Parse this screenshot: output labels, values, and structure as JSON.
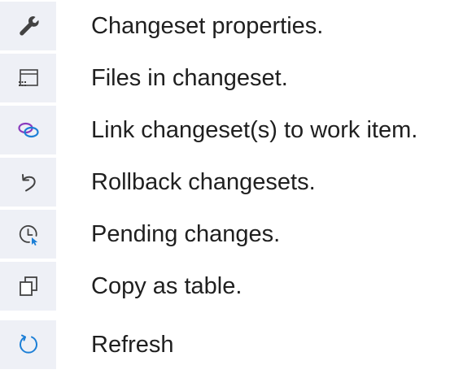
{
  "items": [
    {
      "icon": "wrench-icon",
      "label": "Changeset properties."
    },
    {
      "icon": "window-files-icon",
      "label": "Files in changeset."
    },
    {
      "icon": "link-icon",
      "label": "Link changeset(s) to work item."
    },
    {
      "icon": "undo-arrow-icon",
      "label": "Rollback changesets."
    },
    {
      "icon": "clock-pending-icon",
      "label": "Pending changes."
    },
    {
      "icon": "copy-icon",
      "label": "Copy as table."
    },
    {
      "icon": "refresh-icon",
      "label": "Refresh"
    }
  ],
  "colors": {
    "icon_background": "#eef0f6",
    "icon_dark": "#424242",
    "link_purple": "#8a3bbd",
    "link_blue": "#1c7fd6",
    "accent_blue": "#1c7fd6",
    "text": "#1f1f1f"
  }
}
